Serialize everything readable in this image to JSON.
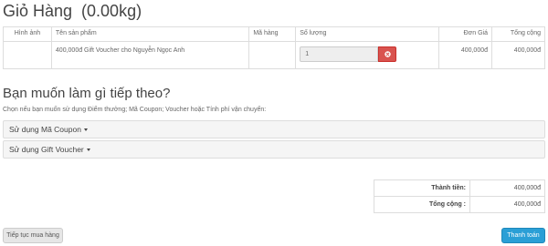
{
  "page": {
    "title": "Giỏ Hàng  (0.00kg)"
  },
  "cart": {
    "headers": {
      "image": "Hình ảnh",
      "name": "Tên sản phẩm",
      "model": "Mã hàng",
      "quantity": "Số lượng",
      "unit_price": "Đơn Giá",
      "total": "Tổng cộng"
    },
    "rows": [
      {
        "image": "",
        "name": "400,000đ Gift Voucher cho Nguyễn Ngọc Anh",
        "model": "",
        "quantity": "1",
        "unit_price": "400,000đ",
        "total": "400,000đ"
      }
    ],
    "remove_icon": "remove-circle-icon"
  },
  "next": {
    "title": "Bạn muốn làm gì tiếp theo?",
    "description": "Chọn nếu bạn muốn sử dụng Điểm thưởng; Mã Coupon; Voucher hoặc Tính phí vận chuyển:",
    "panels": [
      {
        "label": "Sử dụng Mã Coupon"
      },
      {
        "label": "Sử dụng Gift Voucher"
      }
    ]
  },
  "totals": {
    "rows": [
      {
        "label": "Thành tiền:",
        "value": "400,000đ"
      },
      {
        "label": "Tổng cộng :",
        "value": "400,000đ"
      }
    ]
  },
  "actions": {
    "continue_label": "Tiếp tục mua hàng",
    "checkout_label": "Thanh toán"
  },
  "colors": {
    "danger": "#d9534f",
    "primary": "#2a9fd6",
    "panel_bg": "#f5f5f5",
    "border": "#dddddd"
  }
}
